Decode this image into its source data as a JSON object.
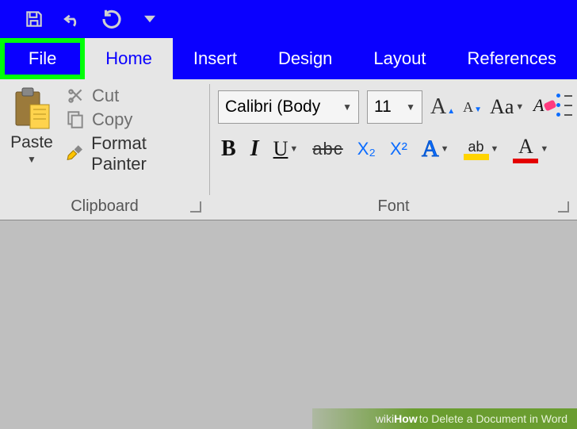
{
  "qat": {
    "save": "save",
    "undo": "undo",
    "redo": "redo",
    "more": "more"
  },
  "tabs": {
    "file": "File",
    "home": "Home",
    "insert": "Insert",
    "design": "Design",
    "layout": "Layout",
    "references": "References"
  },
  "clipboard": {
    "paste": "Paste",
    "cut": "Cut",
    "copy": "Copy",
    "format_painter": "Format Painter",
    "group_label": "Clipboard"
  },
  "font": {
    "name": "Calibri (Body",
    "size": "11",
    "bold": "B",
    "italic": "I",
    "underline": "U",
    "strike": "abc",
    "subscript": "X₂",
    "superscript": "X²",
    "text_effects": "A",
    "highlight_label": "ab",
    "font_color_label": "A",
    "grow": "A",
    "shrink": "A",
    "change_case": "Aa",
    "group_label": "Font"
  },
  "caption": {
    "wiki": "wiki",
    "how": "How",
    "rest": " to Delete a Document in Word"
  }
}
